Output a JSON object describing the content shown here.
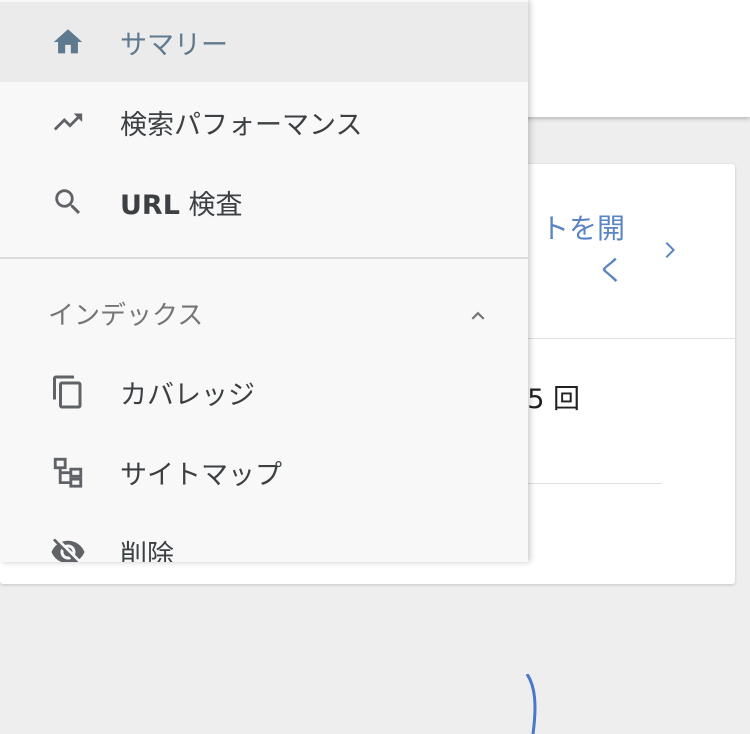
{
  "drawer": {
    "items": [
      {
        "label": "サマリー",
        "icon": "home-icon",
        "active": true
      },
      {
        "label": "検索パフォーマンス",
        "icon": "trending-up-icon"
      },
      {
        "label_bold": "URL",
        "label": " 検査",
        "icon": "search-icon"
      }
    ],
    "section": {
      "title": "インデックス",
      "expanded": true,
      "items": [
        {
          "label": "カバレッジ",
          "icon": "copy-icon"
        },
        {
          "label": "サイトマップ",
          "icon": "sitemap-icon"
        },
        {
          "label": "削除",
          "icon": "visibility-off-icon"
        }
      ]
    }
  },
  "background": {
    "card_link_text": "トを開\nく",
    "count_text": "5 回"
  },
  "colors": {
    "active_bg": "#ebebeb",
    "active_text": "#5f7a8f",
    "link": "#5a84c4"
  }
}
